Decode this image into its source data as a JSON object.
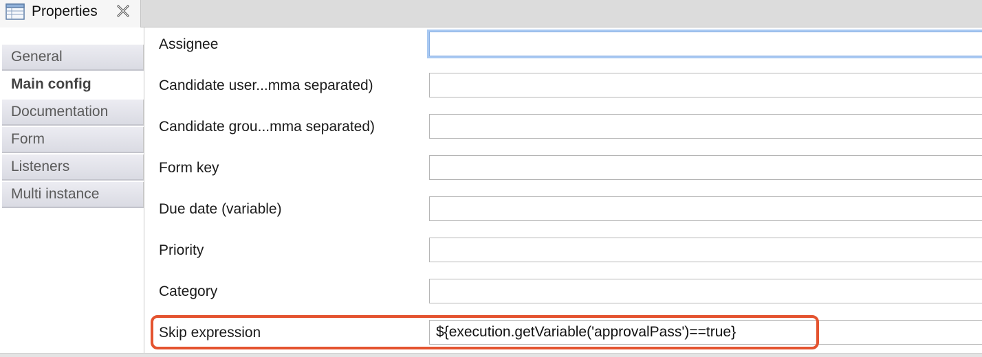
{
  "view_tab": {
    "title": "Properties",
    "icon": "table-icon",
    "close_icon": "close-icon"
  },
  "sidebar": {
    "selected": "Main config",
    "items": [
      {
        "label": "General"
      },
      {
        "label": "Main config"
      },
      {
        "label": "Documentation"
      },
      {
        "label": "Form"
      },
      {
        "label": "Listeners"
      },
      {
        "label": "Multi instance"
      }
    ]
  },
  "form": {
    "rows": [
      {
        "label": "Assignee",
        "value": ""
      },
      {
        "label": "Candidate user...mma separated)",
        "value": ""
      },
      {
        "label": "Candidate grou...mma separated)",
        "value": ""
      },
      {
        "label": "Form key",
        "value": ""
      },
      {
        "label": "Due date (variable)",
        "value": ""
      },
      {
        "label": "Priority",
        "value": ""
      },
      {
        "label": "Category",
        "value": ""
      },
      {
        "label": "Skip expression",
        "value": "${execution.getVariable('approvalPass')==true}"
      }
    ]
  },
  "colors": {
    "highlight": "#e4532f",
    "focus_ring": "#a9c9f2",
    "sidebar_tab": "#dadbe3"
  }
}
